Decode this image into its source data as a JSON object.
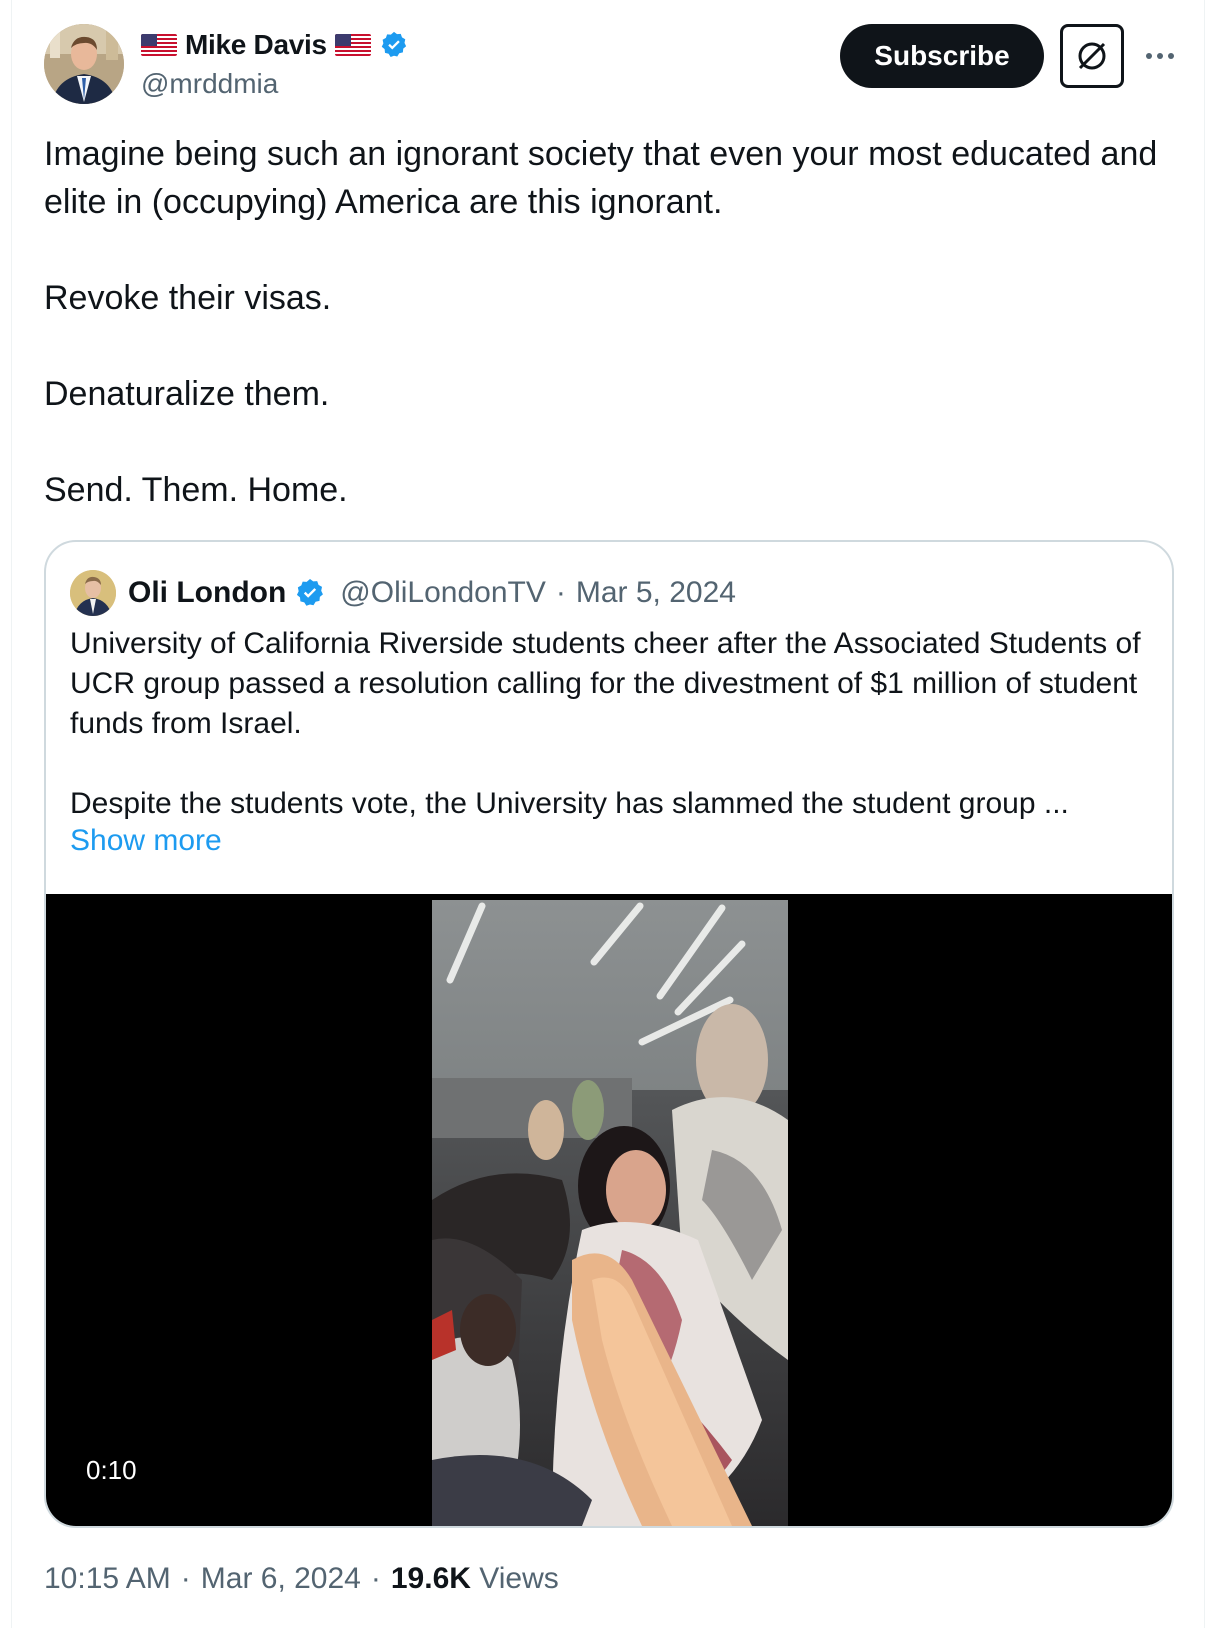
{
  "author": {
    "display_name": "Mike Davis",
    "handle": "@mrddmia",
    "flag_emoji": "us-flag-icon",
    "verified": true
  },
  "actions": {
    "subscribe_label": "Subscribe",
    "grok_icon": "grok-icon",
    "more_icon": "more-icon"
  },
  "tweet": {
    "paragraphs": [
      "Imagine being such an ignorant society that even your most educated and elite in (occupying) America are this ignorant.",
      "Revoke their visas.",
      "Denaturalize them.",
      "Send. Them. Home."
    ]
  },
  "quoted_tweet": {
    "display_name": "Oli London",
    "handle": "@OliLondonTV",
    "separator": "·",
    "date": "Mar 5, 2024",
    "verified": true,
    "paragraphs": [
      "University of California Riverside students cheer after the Associated Students of UCR group passed a resolution calling for the divestment of $1 million of student funds from Israel.",
      "Despite the students vote, the University has slammed the student group ..."
    ],
    "show_more_label": "Show more",
    "video": {
      "duration": "0:10"
    }
  },
  "meta": {
    "time": "10:15 AM",
    "separator": "·",
    "date": "Mar 6, 2024",
    "views_count": "19.6K",
    "views_label": "Views"
  },
  "colors": {
    "text_primary": "#0f1419",
    "text_secondary": "#536471",
    "accent_blue": "#1d9bf0",
    "border": "#cfd9de"
  }
}
